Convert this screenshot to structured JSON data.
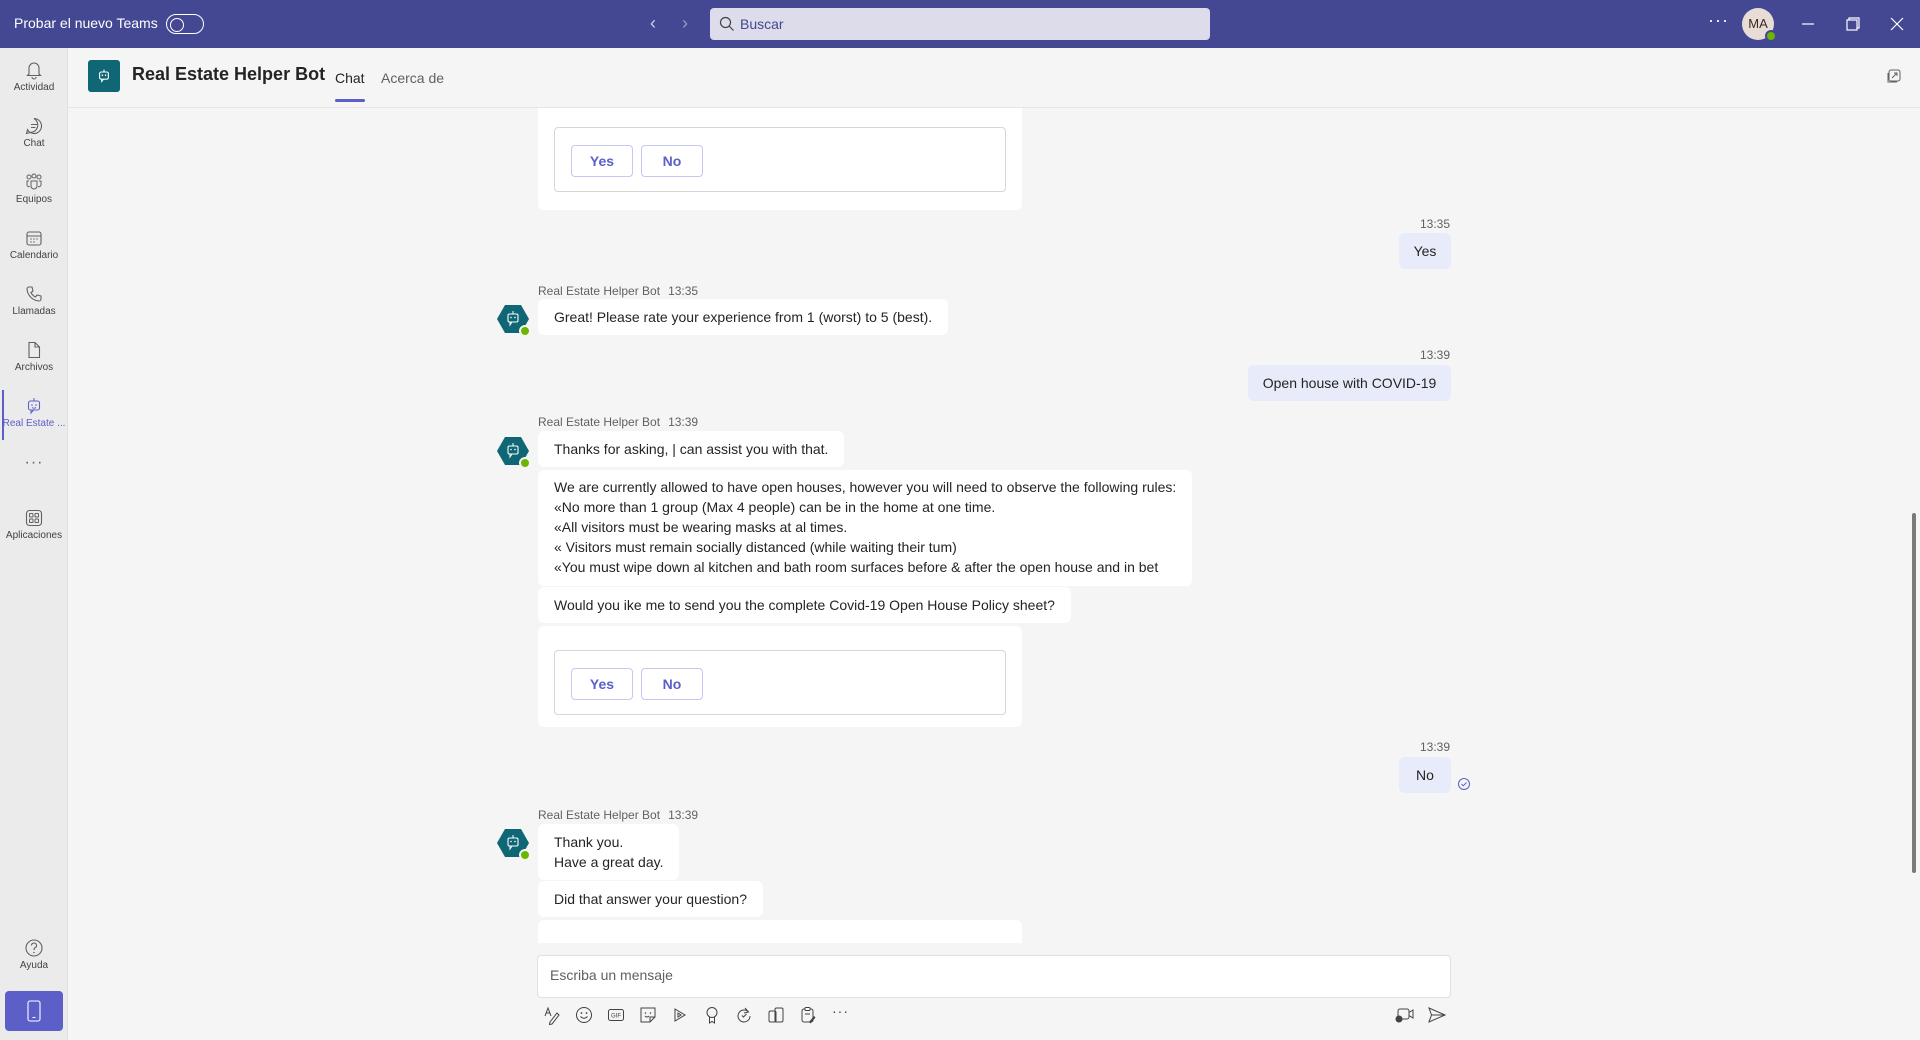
{
  "titlebar": {
    "try_new_teams": "Probar el nuevo Teams",
    "search_placeholder": "Buscar",
    "more": "···",
    "avatar_initials": "MA",
    "nav_back": "‹",
    "nav_forward": "›"
  },
  "rail": {
    "items": [
      {
        "label": "Actividad",
        "icon": "bell-icon"
      },
      {
        "label": "Chat",
        "icon": "chat-icon"
      },
      {
        "label": "Equipos",
        "icon": "teams-icon"
      },
      {
        "label": "Calendario",
        "icon": "calendar-icon"
      },
      {
        "label": "Llamadas",
        "icon": "phone-icon"
      },
      {
        "label": "Archivos",
        "icon": "file-icon"
      },
      {
        "label": "Real Estate ...",
        "icon": "bot-icon",
        "active": true
      }
    ],
    "more": "···",
    "apps_label": "Aplicaciones",
    "help_label": "Ayuda"
  },
  "header": {
    "title": "Real Estate Helper Bot",
    "tabs": [
      {
        "label": "Chat",
        "active": true
      },
      {
        "label": "Acerca de",
        "active": false
      }
    ]
  },
  "chat": {
    "bot_name": "Real Estate Helper Bot",
    "messages": [
      {
        "type": "card",
        "buttons": [
          "Yes",
          "No"
        ]
      },
      {
        "type": "user",
        "time": "13:35",
        "text": "Yes"
      },
      {
        "type": "bot",
        "time": "13:35",
        "bubbles": [
          "Great! Please rate your experience from 1 (worst) to 5 (best)."
        ]
      },
      {
        "type": "user",
        "time": "13:39",
        "text": "Open house with COVID-19"
      },
      {
        "type": "bot",
        "time": "13:39",
        "bubbles": [
          "Thanks for asking, | can assist you with that.",
          [
            "We are currently allowed to have open houses, however you will need to observe the following rules:",
            "«No more than 1 group (Max 4 people) can be in the home at one time.",
            "«All visitors must be wearing masks at al times.",
            "« Visitors must remain socially distanced (while waiting their tum)",
            "«You must wipe down al kitchen and bath room surfaces before & after the open house and in bet"
          ],
          "Would you ike me to send you the complete Covid-19 Open House Policy sheet?"
        ],
        "card_buttons": [
          "Yes",
          "No"
        ]
      },
      {
        "type": "user",
        "time": "13:39",
        "text": "No",
        "status": "seen"
      },
      {
        "type": "bot",
        "time": "13:39",
        "bubbles": [
          [
            "Thank you.",
            "Have a great day."
          ],
          "Did that answer your question?"
        ]
      }
    ]
  },
  "composer": {
    "placeholder": "Escriba un mensaje",
    "tools": [
      "format-icon",
      "emoji-icon",
      "gif-icon",
      "sticker-icon",
      "stream-icon",
      "praise-icon",
      "loop-icon",
      "attach-icon",
      "approvals-icon"
    ],
    "more": "···"
  },
  "colors": {
    "brand": "#444791",
    "accent": "#5b5fc7",
    "bot_teal": "#0f6674",
    "presence": "#6bb700",
    "user_bubble": "#e8ebfa"
  }
}
